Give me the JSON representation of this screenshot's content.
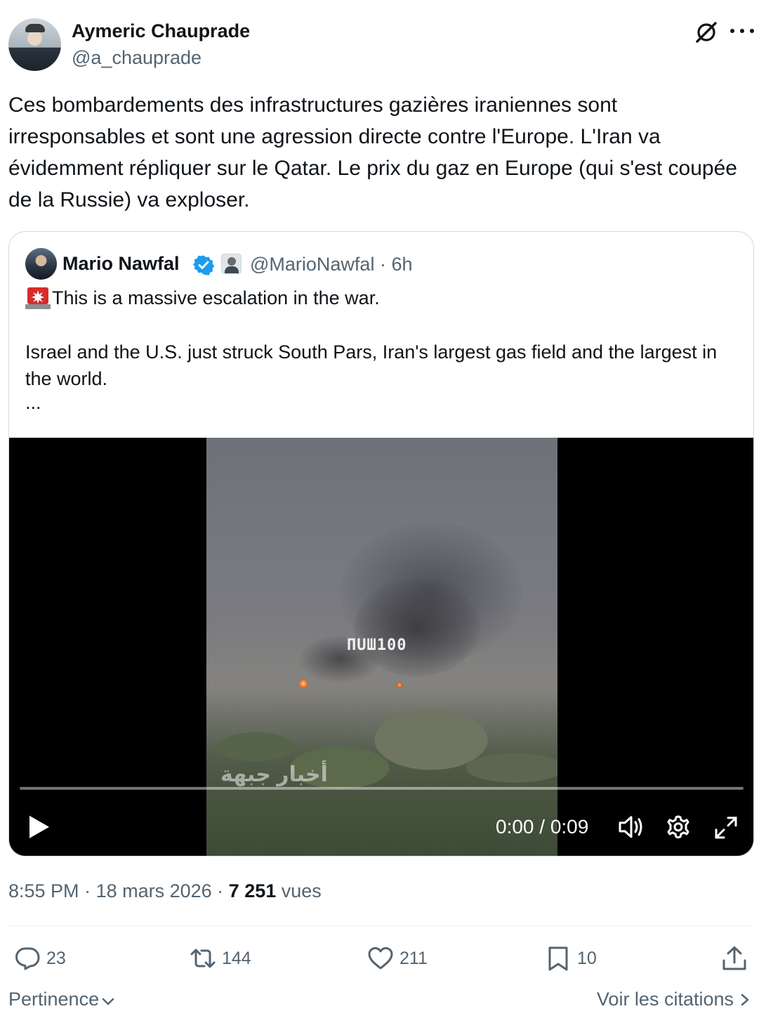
{
  "author": {
    "name": "Aymeric Chauprade",
    "handle": "@a_chauprade"
  },
  "tweet": {
    "text": "Ces bombardements des infrastructures gazières iraniennes sont irresponsables et sont une agression directe contre l'Europe. L'Iran va évidemment répliquer sur le Qatar. Le prix du gaz en Europe (qui s'est coupée de la Russie) va exploser."
  },
  "quote": {
    "name": "Mario Nawfal",
    "meta": "@MarioNawfal · 6h",
    "line1": "This is a massive escalation in the war.",
    "line2": "Israel and the U.S. just struck South Pars, Iran's largest gas field and the largest in the world.",
    "ellipsis": "..."
  },
  "video": {
    "watermark": "ПUШ100",
    "arabic_watermark": "أخبار جبهة",
    "time": "0:00 / 0:09",
    "progress": 0
  },
  "footer": {
    "time": "8:55 PM",
    "date": "18 mars 2026",
    "views_count": "7 251",
    "views_label": "vues"
  },
  "actions": {
    "replies": "23",
    "reposts": "144",
    "likes": "211",
    "bookmarks": "10"
  },
  "sort_label": "Pertinence",
  "quotes_label": "Voir les citations",
  "colors": {
    "accent": "#1d9bf0",
    "muted": "#536471",
    "text": "#0f1419"
  }
}
